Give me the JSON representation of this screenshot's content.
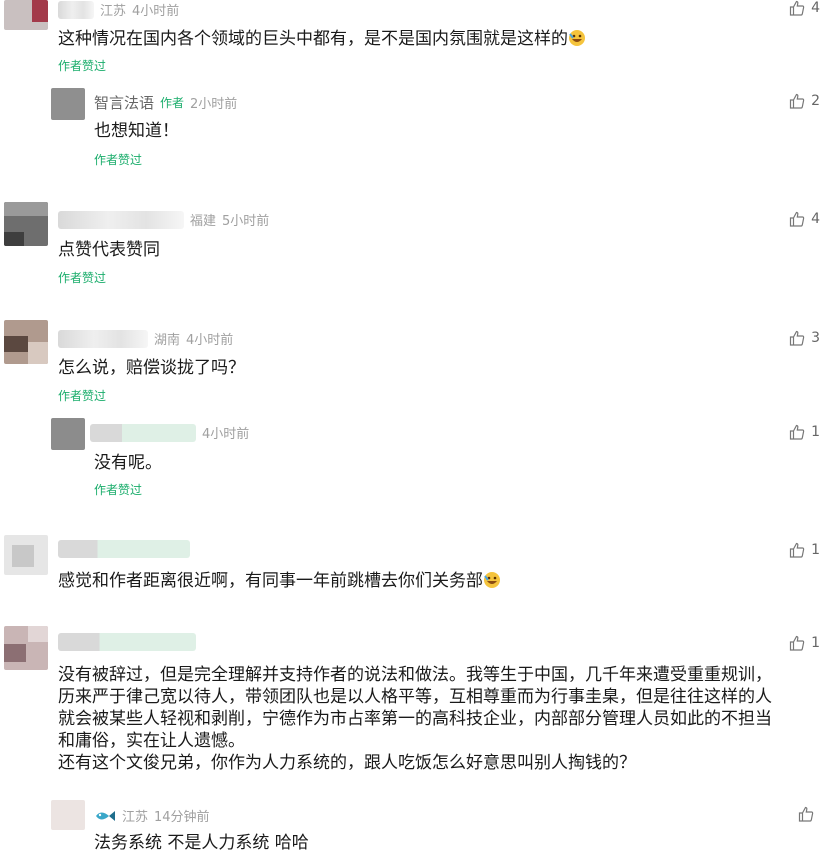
{
  "liked_by_author": "作者赞过",
  "author_tag": "作者",
  "comments": [
    {
      "region": "江苏",
      "time": "4小时前",
      "text": "这种情况在国内各个领域的巨头中都有，是不是国内氛围就是这样的",
      "likes": "4"
    },
    {
      "name": "智言法语",
      "time": "2小时前",
      "text": "也想知道！",
      "likes": "2"
    },
    {
      "region": "福建",
      "time": "5小时前",
      "text": "点赞代表赞同",
      "likes": "4"
    },
    {
      "region": "湖南",
      "time": "4小时前",
      "text": "怎么说，赔偿谈拢了吗？",
      "likes": "3"
    },
    {
      "time": "4小时前",
      "text": "没有呢。",
      "likes": "1"
    },
    {
      "text": "感觉和作者距离很近啊，有同事一年前跳槽去你们关务部",
      "likes": "1"
    },
    {
      "text_lines": [
        "没有被辞过，但是完全理解并支持作者的说法和做法。我等生于中国，几千年来遭受重重规训，",
        "历来严于律己宽以待人，带领团队也是以人格平等，互相尊重而为行事圭臬，但是往往这样的人",
        "就会被某些人轻视和剥削，宁德作为市占率第一的高科技企业，内部部分管理人员如此的不担当",
        "和庸俗，实在让人遗憾。",
        "还有这个文俊兄弟，你作为人力系统的，跟人吃饭怎么好意思叫别人掏钱的？"
      ],
      "likes": "1"
    },
    {
      "region": "江苏",
      "time": "14分钟前",
      "text": "法务系统 不是人力系统 哈哈",
      "likes": ""
    }
  ]
}
